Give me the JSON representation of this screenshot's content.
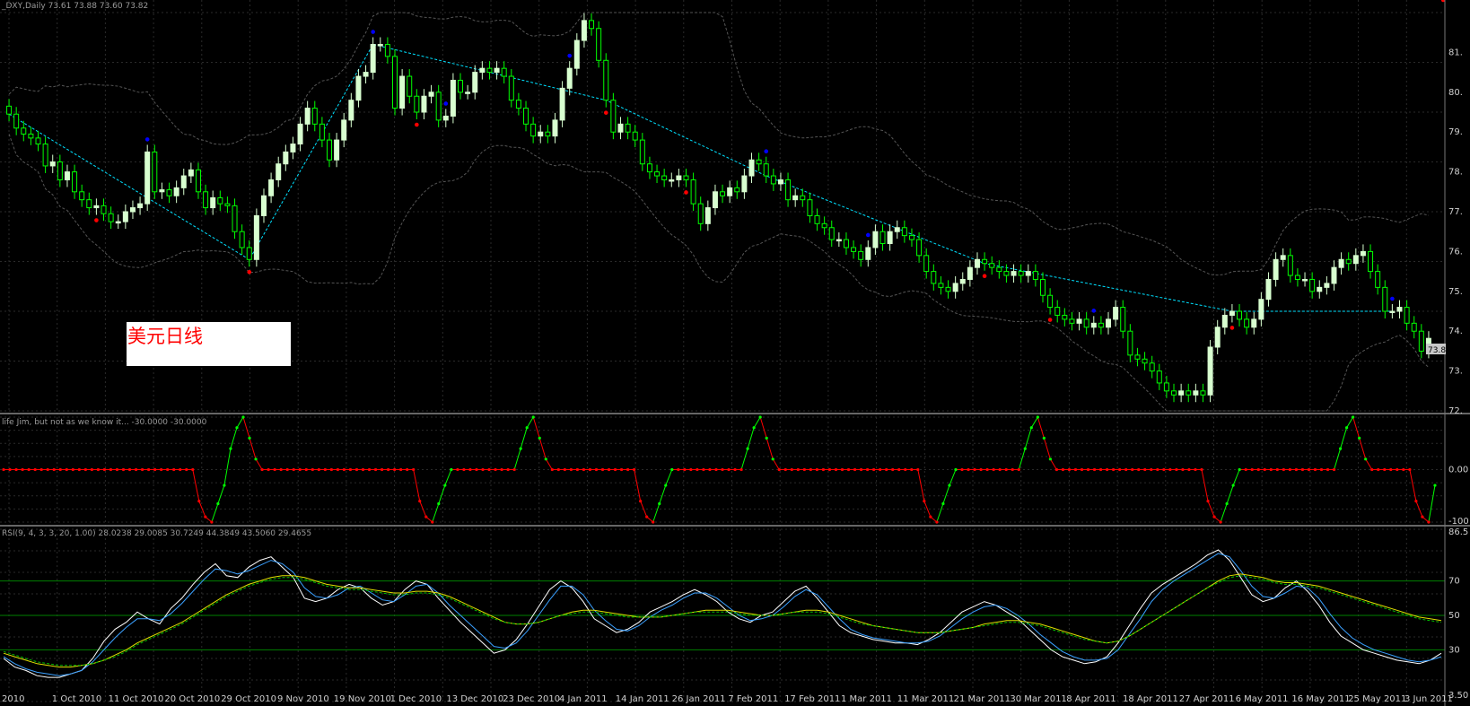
{
  "panels": {
    "main": {
      "header": "_DXY,Daily  73.61 73.88 73.60 73.82",
      "price_tag": "73.8"
    },
    "osc": {
      "header": "life Jim, but not as we know it...  -30.0000 -30.0000"
    },
    "rsi": {
      "header": "RSI(9, 4, 3, 3, 20, 1.00) 28.0238 29.0085 30.7249 44.3849 43.5060 29.4655"
    }
  },
  "annotation": {
    "label": "美元日线"
  },
  "x_labels": [
    "2010",
    "1 Oct 2010",
    "11 Oct 2010",
    "20 Oct 2010",
    "29 Oct 2010",
    "9 Nov 2010",
    "19 Nov 2010",
    "1 Dec 2010",
    "13 Dec 2010",
    "23 Dec 2010",
    "4 Jan 2011",
    "14 Jan 2011",
    "26 Jan 2011",
    "7 Feb 2011",
    "17 Feb 2011",
    "1 Mar 2011",
    "11 Mar 2011",
    "21 Mar 2011",
    "30 Mar 2011",
    "8 Apr 2011",
    "18 Apr 2011",
    "27 Apr 2011",
    "6 May 2011",
    "16 May 2011",
    "25 May 2011",
    "3 Jun 2011"
  ],
  "colors": {
    "bull": "#d8ffd0",
    "bear": "#00ff00",
    "up": "#00ff00",
    "down": "#ff0000",
    "trend": "#00e0ff",
    "band": "#555555",
    "blue": "#0000ff",
    "level": "#008000"
  },
  "chart_data": [
    {
      "type": "candlestick",
      "title": "_DXY,Daily",
      "ylim": [
        72,
        82
      ],
      "y_ticks": [
        "81.",
        "80.",
        "79.",
        "78.",
        "77.",
        "76.",
        "75.",
        "74.",
        "73.",
        "72."
      ],
      "close": [
        79.45,
        79.1,
        78.95,
        78.85,
        78.7,
        78.15,
        78.25,
        77.8,
        78.0,
        77.5,
        77.3,
        77.1,
        77.15,
        76.95,
        76.75,
        76.75,
        77.0,
        77.1,
        77.2,
        78.5,
        77.5,
        77.55,
        77.4,
        77.6,
        77.9,
        78.05,
        77.5,
        77.1,
        77.35,
        77.2,
        77.15,
        76.5,
        76.1,
        75.8,
        76.9,
        77.4,
        77.8,
        78.2,
        78.5,
        78.7,
        79.2,
        79.6,
        79.2,
        78.8,
        78.3,
        78.8,
        79.3,
        79.8,
        80.4,
        80.5,
        81.2,
        81.2,
        80.9,
        79.6,
        80.4,
        79.9,
        79.5,
        79.9,
        80.0,
        79.3,
        79.4,
        80.3,
        80.0,
        80.0,
        80.5,
        80.6,
        80.5,
        80.6,
        80.4,
        79.8,
        79.6,
        79.2,
        78.9,
        79.0,
        78.9,
        79.3,
        80.1,
        80.6,
        81.3,
        81.8,
        81.6,
        80.8,
        79.8,
        79.0,
        79.2,
        79.0,
        78.8,
        78.2,
        78.0,
        77.9,
        77.8,
        77.8,
        77.9,
        77.8,
        77.2,
        76.7,
        77.1,
        77.5,
        77.4,
        77.6,
        77.5,
        77.9,
        78.3,
        78.2,
        77.9,
        77.7,
        77.8,
        77.3,
        77.4,
        77.3,
        76.9,
        76.7,
        76.6,
        76.3,
        76.3,
        76.1,
        76.0,
        75.8,
        76.1,
        76.5,
        76.2,
        76.5,
        76.6,
        76.4,
        76.3,
        75.9,
        75.5,
        75.2,
        75.1,
        75.0,
        75.2,
        75.3,
        75.6,
        75.8,
        75.7,
        75.6,
        75.5,
        75.4,
        75.5,
        75.4,
        75.5,
        75.3,
        74.9,
        74.6,
        74.4,
        74.3,
        74.2,
        74.3,
        74.1,
        74.2,
        74.1,
        74.3,
        74.6,
        74.0,
        73.4,
        73.3,
        73.2,
        73.0,
        72.7,
        72.5,
        72.4,
        72.5,
        72.4,
        72.5,
        72.4,
        73.6,
        74.1,
        74.4,
        74.5,
        74.3,
        74.1,
        74.3,
        74.8,
        75.3,
        75.8,
        75.9,
        75.4,
        75.3,
        75.3,
        75.0,
        75.1,
        75.2,
        75.6,
        75.8,
        75.7,
        75.9,
        76.0,
        75.5,
        75.1,
        74.5,
        74.5,
        74.6,
        74.2,
        74.0,
        73.5,
        73.82
      ],
      "lower_band_markers": "red dots below, blue dots above",
      "trend_line": "zigzag"
    },
    {
      "type": "line",
      "title": "life Jim, but not as we know it...",
      "ylim": [
        -100,
        100
      ],
      "y_ticks": [
        "0.00",
        "-100"
      ],
      "series": [
        {
          "values": [
            0,
            0,
            0,
            0,
            0,
            0,
            0,
            0,
            0,
            0,
            0,
            0,
            0,
            0,
            0,
            0,
            0,
            0,
            0,
            0,
            0,
            0,
            0,
            0,
            0,
            0,
            0,
            0,
            0,
            0,
            0,
            -60,
            -90,
            -100,
            -65,
            -30,
            40,
            80,
            100,
            60,
            20,
            0,
            0,
            0,
            0,
            0,
            0,
            0,
            0,
            0,
            0,
            0,
            0,
            0,
            0,
            0,
            0,
            0,
            0,
            0,
            0,
            0,
            0,
            0,
            0,
            0,
            -60,
            -90,
            -100,
            -65,
            -30,
            0,
            0,
            0,
            0,
            0,
            0,
            0,
            0,
            0,
            0,
            0,
            40,
            80,
            100,
            60,
            20,
            0,
            0,
            0,
            0,
            0,
            0,
            0,
            0,
            0,
            0,
            0,
            0,
            0,
            0,
            -60,
            -90,
            -100,
            -65,
            -30,
            0,
            0,
            0,
            0,
            0,
            0,
            0,
            0,
            0,
            0,
            0,
            0,
            40,
            80,
            100,
            60,
            20,
            0,
            0,
            0,
            0,
            0,
            0,
            0,
            0,
            0,
            0,
            0,
            0,
            0,
            0,
            0,
            0,
            0,
            0,
            0,
            0,
            0,
            0,
            0,
            -60,
            -90,
            -100,
            -65,
            -30,
            0,
            0,
            0,
            0,
            0,
            0,
            0,
            0,
            0,
            0,
            0,
            40,
            80,
            100,
            60,
            20,
            0,
            0,
            0,
            0,
            0,
            0,
            0,
            0,
            0,
            0,
            0,
            0,
            0,
            0,
            0,
            0,
            0,
            0,
            0,
            0,
            0,
            0,
            0,
            0,
            -60,
            -90,
            -100,
            -65,
            -30,
            0,
            0,
            0,
            0,
            0,
            0,
            0,
            0,
            0,
            0,
            0,
            0,
            0,
            0,
            0,
            0,
            40,
            80,
            100,
            60,
            20,
            0,
            0,
            0,
            0,
            0,
            0,
            0,
            -60,
            -90,
            -100,
            -30
          ]
        }
      ]
    },
    {
      "type": "line",
      "title": "RSI(9, 4, 3, 3, 20, 1.00)",
      "ylim": [
        0,
        100
      ],
      "y_ticks": [
        "86.5",
        "70",
        "50",
        "30",
        "3.50"
      ],
      "levels": [
        70,
        50,
        30
      ],
      "series": [
        {
          "name": "white",
          "values": [
            25,
            20,
            18,
            15,
            14,
            14,
            16,
            18,
            25,
            35,
            42,
            46,
            52,
            48,
            45,
            54,
            60,
            68,
            75,
            80,
            73,
            72,
            78,
            82,
            84,
            78,
            72,
            60,
            58,
            60,
            65,
            68,
            66,
            60,
            56,
            58,
            65,
            70,
            68,
            60,
            53,
            46,
            40,
            34,
            28,
            30,
            36,
            45,
            55,
            65,
            70,
            66,
            58,
            48,
            44,
            40,
            42,
            46,
            52,
            55,
            58,
            62,
            65,
            62,
            58,
            52,
            48,
            46,
            50,
            52,
            58,
            64,
            67,
            60,
            52,
            44,
            40,
            38,
            36,
            35,
            34,
            34,
            33,
            36,
            40,
            46,
            52,
            55,
            58,
            56,
            52,
            48,
            42,
            36,
            30,
            26,
            24,
            22,
            23,
            26,
            34,
            44,
            54,
            63,
            68,
            72,
            76,
            80,
            85,
            88,
            82,
            72,
            62,
            58,
            60,
            66,
            70,
            64,
            56,
            46,
            38,
            34,
            30,
            28,
            26,
            24,
            23,
            22,
            24,
            28
          ]
        },
        {
          "name": "blue",
          "values": [
            26,
            22,
            19,
            17,
            16,
            15,
            16,
            18,
            23,
            30,
            37,
            43,
            48,
            48,
            47,
            51,
            57,
            64,
            71,
            77,
            76,
            74,
            76,
            79,
            82,
            80,
            75,
            66,
            61,
            60,
            62,
            66,
            67,
            63,
            59,
            58,
            62,
            67,
            68,
            63,
            56,
            50,
            44,
            38,
            32,
            31,
            34,
            41,
            50,
            59,
            67,
            67,
            62,
            53,
            47,
            42,
            41,
            44,
            49,
            53,
            56,
            60,
            63,
            63,
            60,
            55,
            50,
            47,
            48,
            50,
            55,
            61,
            65,
            62,
            55,
            48,
            42,
            39,
            37,
            36,
            35,
            34,
            34,
            35,
            38,
            43,
            48,
            52,
            55,
            56,
            54,
            50,
            45,
            39,
            34,
            29,
            26,
            24,
            24,
            25,
            30,
            39,
            48,
            58,
            65,
            70,
            74,
            78,
            82,
            86,
            84,
            76,
            67,
            61,
            60,
            63,
            67,
            66,
            60,
            51,
            43,
            37,
            33,
            30,
            28,
            26,
            24,
            23,
            24,
            26
          ]
        },
        {
          "name": "yellow",
          "values": [
            28,
            26,
            24,
            22,
            21,
            20,
            20,
            21,
            22,
            24,
            27,
            30,
            34,
            37,
            40,
            43,
            46,
            50,
            54,
            58,
            62,
            65,
            68,
            70,
            72,
            73,
            73,
            72,
            70,
            68,
            67,
            66,
            66,
            65,
            64,
            63,
            63,
            64,
            64,
            63,
            61,
            58,
            55,
            52,
            49,
            46,
            45,
            45,
            46,
            48,
            50,
            52,
            53,
            53,
            52,
            51,
            50,
            49,
            49,
            49,
            50,
            51,
            52,
            53,
            53,
            53,
            52,
            51,
            50,
            50,
            51,
            52,
            53,
            53,
            52,
            50,
            48,
            46,
            44,
            43,
            42,
            41,
            40,
            40,
            40,
            41,
            42,
            43,
            45,
            46,
            47,
            47,
            46,
            45,
            43,
            41,
            39,
            37,
            35,
            34,
            35,
            38,
            42,
            46,
            50,
            54,
            58,
            62,
            66,
            70,
            73,
            74,
            73,
            72,
            70,
            69,
            69,
            68,
            67,
            65,
            63,
            61,
            59,
            57,
            55,
            53,
            51,
            49,
            48,
            47
          ]
        },
        {
          "name": "green",
          "values": [
            29,
            27,
            25,
            23,
            22,
            21,
            21,
            21,
            22,
            24,
            26,
            29,
            33,
            36,
            39,
            42,
            45,
            49,
            53,
            57,
            61,
            64,
            67,
            69,
            71,
            72,
            72,
            71,
            69,
            67,
            66,
            65,
            65,
            64,
            63,
            62,
            62,
            63,
            63,
            62,
            60,
            57,
            54,
            51,
            48,
            46,
            45,
            45,
            46,
            48,
            50,
            51,
            52,
            52,
            51,
            50,
            49,
            49,
            49,
            49,
            50,
            51,
            52,
            52,
            52,
            52,
            51,
            50,
            50,
            50,
            51,
            52,
            52,
            52,
            51,
            49,
            47,
            45,
            44,
            43,
            42,
            41,
            40,
            40,
            40,
            41,
            42,
            43,
            44,
            45,
            46,
            46,
            45,
            44,
            42,
            40,
            38,
            36,
            35,
            34,
            35,
            38,
            42,
            46,
            50,
            54,
            58,
            62,
            66,
            69,
            72,
            73,
            72,
            71,
            69,
            68,
            68,
            67,
            66,
            64,
            62,
            60,
            58,
            56,
            54,
            52,
            50,
            48,
            47,
            46
          ]
        }
      ]
    }
  ]
}
